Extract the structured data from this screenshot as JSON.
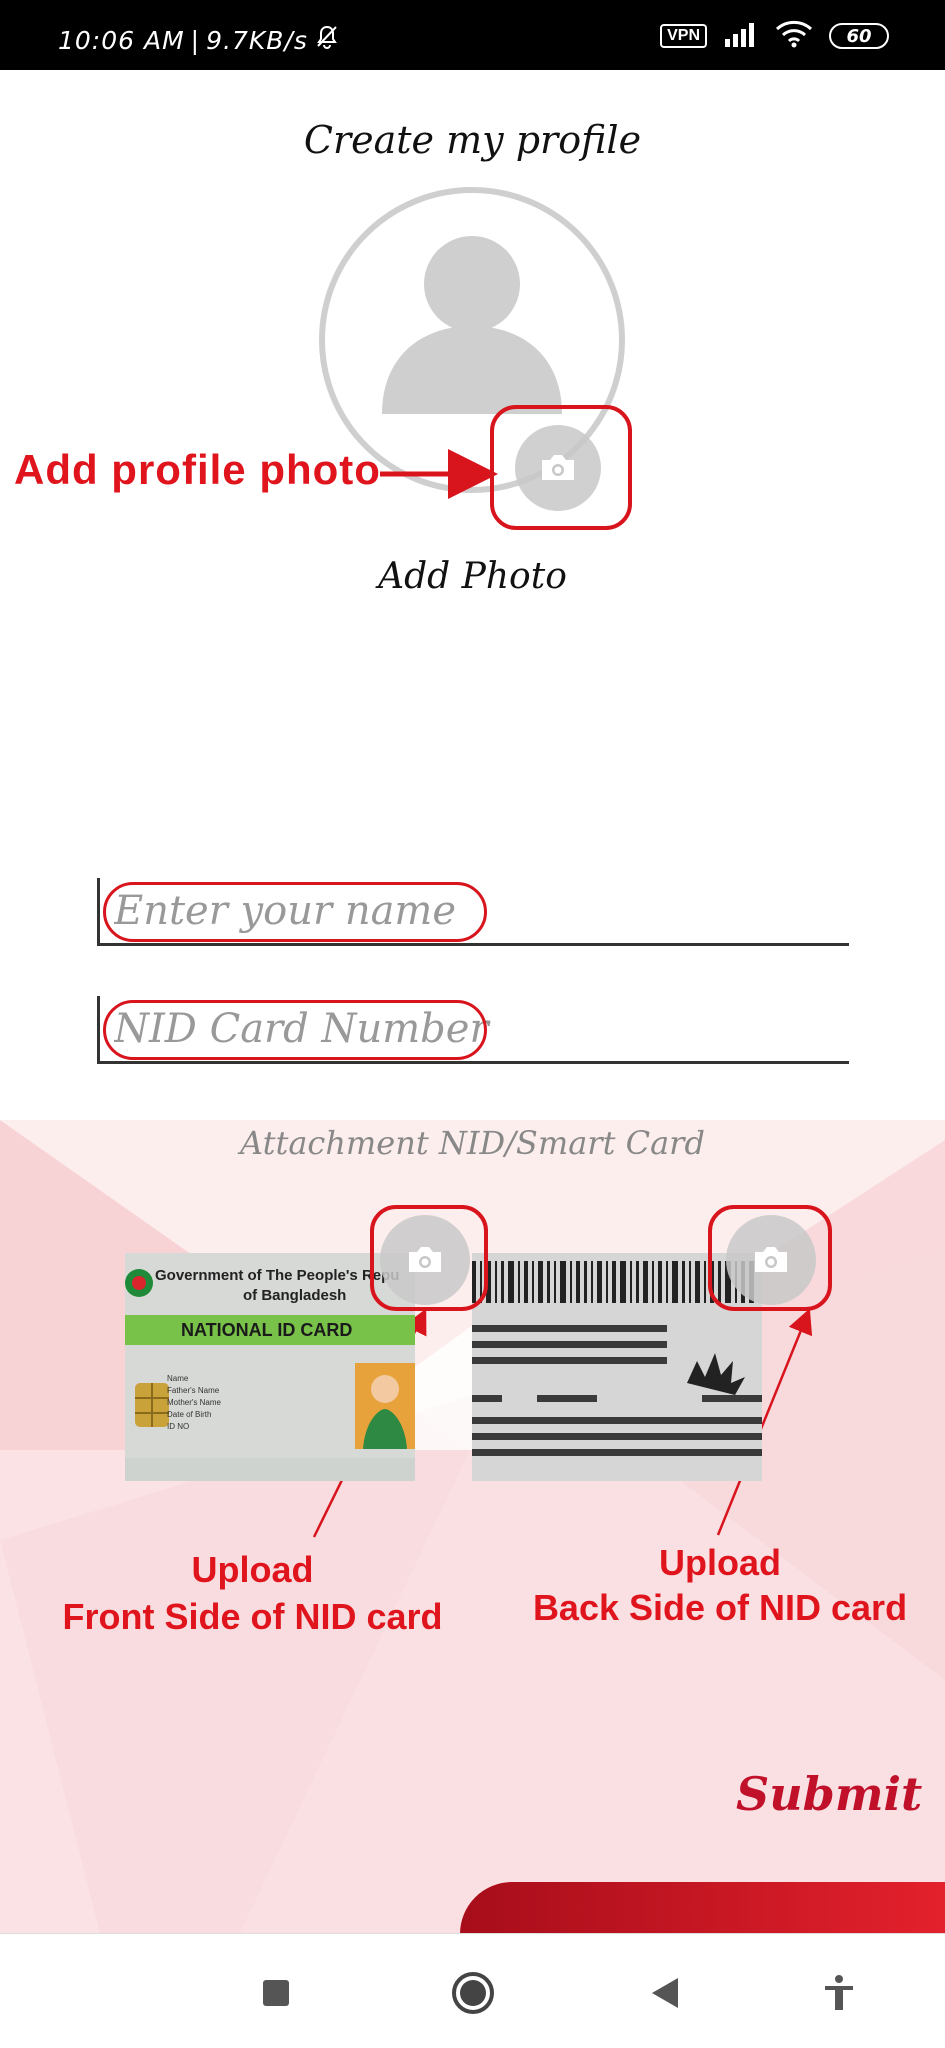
{
  "status_bar": {
    "time": "10:06 AM",
    "separator": "|",
    "speed": "9.7KB/s",
    "vpn": "VPN",
    "battery": "60",
    "icons": [
      "bell-muted-icon",
      "signal-icon",
      "wifi-icon",
      "battery-icon"
    ]
  },
  "page": {
    "title": "Create my profile",
    "add_photo_label": "Add Photo"
  },
  "form": {
    "name_placeholder": "Enter your name",
    "nid_placeholder": "NID Card Number",
    "attachment_label": "Attachment NID/Smart Card"
  },
  "id_card_front": {
    "header_line1": "Government of The People's Repu",
    "header_line2": "of Bangladesh",
    "band_text": "NATIONAL ID CARD",
    "fields": [
      "Name",
      "Father's Name",
      "Mother's Name",
      "Date of Birth",
      "ID NO"
    ]
  },
  "annotations": {
    "profile_photo": "Add profile photo",
    "front_line1": "Upload",
    "front_line2": "Front Side of NID card",
    "back_line1": "Upload",
    "back_line2": "Back Side of NID card"
  },
  "actions": {
    "submit": "Submit"
  },
  "colors": {
    "annotation_red": "#e0141c",
    "submit_red": "#c0102a",
    "background_pink": "#f9dfe1"
  },
  "nav_bar": {
    "icons": [
      "square-recents-icon",
      "circle-home-icon",
      "triangle-back-icon",
      "accessibility-icon"
    ]
  }
}
